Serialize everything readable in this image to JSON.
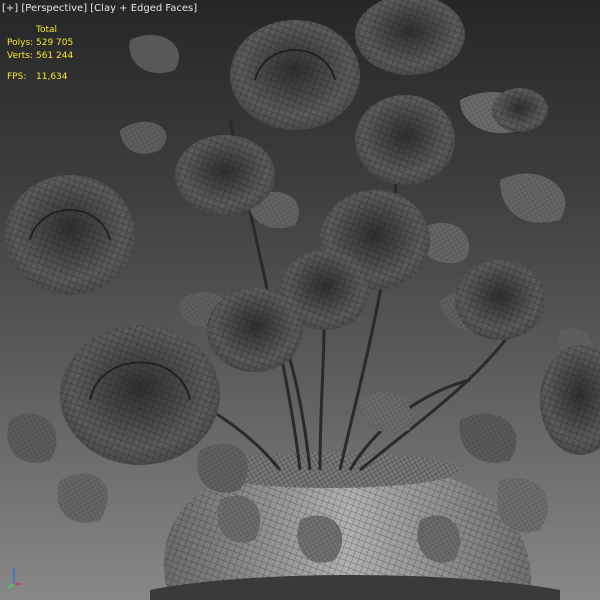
{
  "viewport": {
    "labels": [
      "[+]",
      "[Perspective]",
      "[Clay + Edged Faces]"
    ],
    "stats": {
      "header": "Total",
      "polys_label": "Polys:",
      "polys_value": "529 705",
      "verts_label": "Verts:",
      "verts_value": "561 244",
      "fps_label": "FPS:",
      "fps_value": "11,634"
    },
    "colors": {
      "stats_text": "#f2e93a",
      "label_text": "#e6e6e6",
      "bg_top": "#262626",
      "bg_bottom": "#888888",
      "clay": "#5c5c5c",
      "wire": "#1c1c1c"
    },
    "gizmo_icon": "axis-gizmo-icon"
  }
}
